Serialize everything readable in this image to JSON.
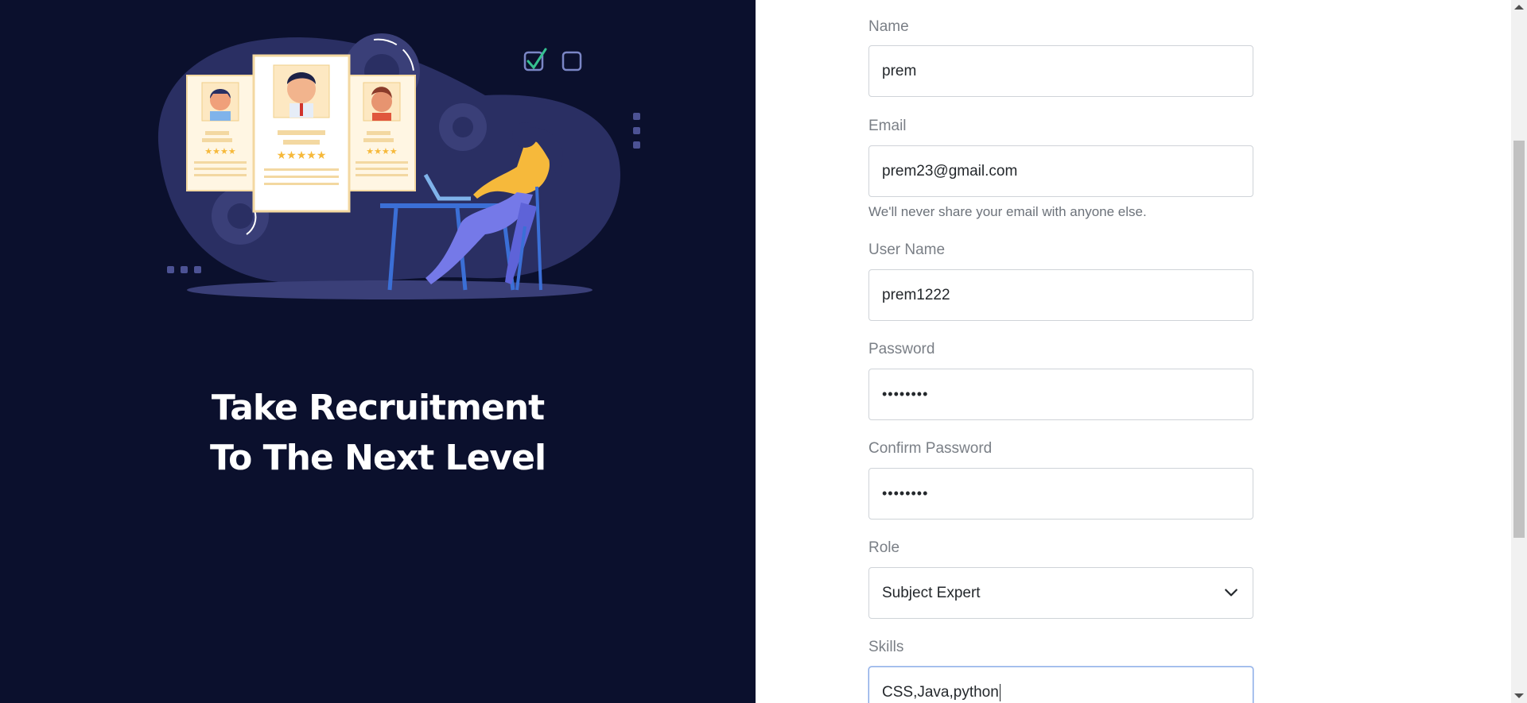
{
  "hero": {
    "tagline_line1": "Take Recruitment",
    "tagline_line2": "To The Next Level"
  },
  "form": {
    "name": {
      "label": "Name",
      "value": "prem"
    },
    "email": {
      "label": "Email",
      "value": "prem23@gmail.com",
      "help": "We'll never share your email with anyone else."
    },
    "username": {
      "label": "User Name",
      "value": "prem1222"
    },
    "password": {
      "label": "Password",
      "value": "••••••••"
    },
    "confirm_password": {
      "label": "Confirm Password",
      "value": "••••••••"
    },
    "role": {
      "label": "Role",
      "value": "Subject Expert"
    },
    "skills": {
      "label": "Skills",
      "value": "CSS,Java,python"
    }
  },
  "colors": {
    "left_bg": "#0b102d",
    "accent_yellow": "#f6b93b",
    "check_green": "#35c08f"
  }
}
